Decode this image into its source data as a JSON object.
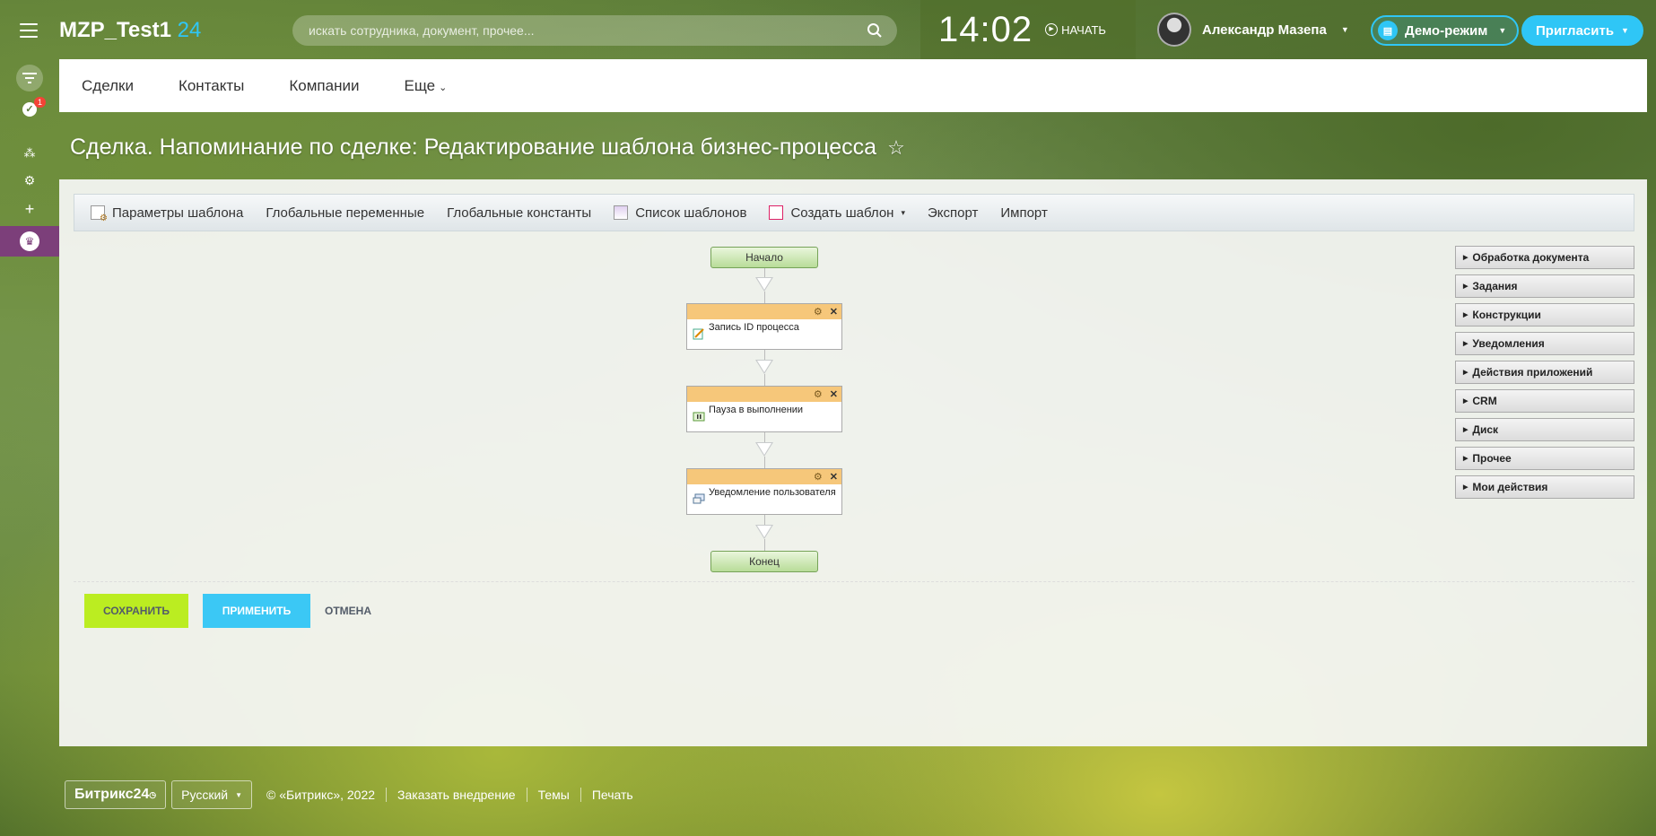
{
  "header": {
    "logo_text": "MZP_Test1",
    "logo_num": "24",
    "search_placeholder": "искать сотрудника, документ, прочее...",
    "clock": "14:02",
    "start_label": "НАЧАТЬ",
    "user_name": "Александр Мазепа",
    "demo_label": "Демо-режим",
    "invite_label": "Пригласить"
  },
  "rail": {
    "tasks_badge": "1"
  },
  "topnav": {
    "items": [
      "Сделки",
      "Контакты",
      "Компании"
    ],
    "more_label": "Еще"
  },
  "page_title": "Сделка. Напоминание по сделке: Редактирование шаблона бизнес-процесса",
  "toolbar": {
    "params": "Параметры шаблона",
    "global_vars": "Глобальные переменные",
    "global_consts": "Глобальные константы",
    "template_list": "Список шаблонов",
    "create_template": "Создать шаблон",
    "export": "Экспорт",
    "import": "Импорт"
  },
  "flow": {
    "start": "Начало",
    "end": "Конец",
    "activities": [
      {
        "title": "Запись ID процесса",
        "icon": "edit-icon"
      },
      {
        "title": "Пауза в выполнении",
        "icon": "pause-icon"
      },
      {
        "title": "Уведомление пользователя",
        "icon": "notify-icon"
      }
    ]
  },
  "side_panel": {
    "items": [
      "Обработка документа",
      "Задания",
      "Конструкции",
      "Уведомления",
      "Действия приложений",
      "CRM",
      "Диск",
      "Прочее",
      "Мои действия"
    ]
  },
  "actions": {
    "save": "СОХРАНИТЬ",
    "apply": "ПРИМЕНИТЬ",
    "cancel": "ОТМЕНА"
  },
  "footer": {
    "logo": "Битрикс24",
    "lang": "Русский",
    "copyright": "© «Битрикс», 2022",
    "order": "Заказать внедрение",
    "themes": "Темы",
    "print": "Печать"
  },
  "colors": {
    "accent_blue": "#2fc6f6",
    "save_green": "#bbed21",
    "activity_header": "#f6c77a"
  }
}
